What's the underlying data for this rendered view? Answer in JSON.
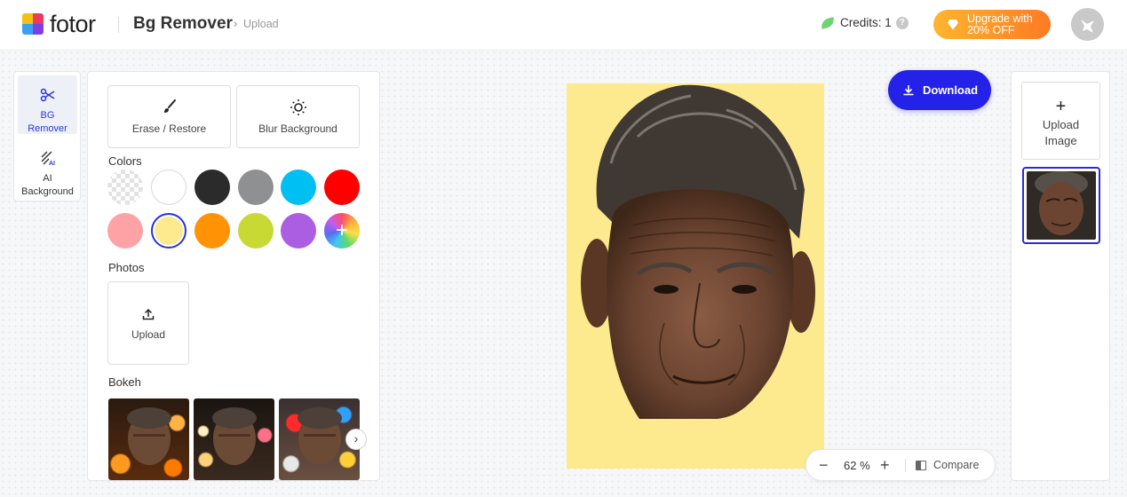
{
  "header": {
    "logo_text": "fotor",
    "product": "Bg Remover",
    "breadcrumb": "Upload",
    "credits": "Credits: 1",
    "upgrade_line1": "Upgrade with",
    "upgrade_line2": "20% OFF"
  },
  "rail": {
    "items": [
      {
        "line1": "BG",
        "line2": "Remover",
        "icon": "scissors-icon",
        "active": true
      },
      {
        "line1": "AI",
        "line2": "Background",
        "icon": "ai-background-icon",
        "active": false
      }
    ]
  },
  "panel": {
    "tools": [
      {
        "label": "Erase / Restore",
        "icon": "brush-icon"
      },
      {
        "label": "Blur Background",
        "icon": "blur-icon"
      }
    ],
    "colors_title": "Colors",
    "colors": [
      "transparent",
      "#ffffff",
      "#2b2b2b",
      "#8e9091",
      "#00bff3",
      "#ff0000",
      "#ffa2a6",
      "#fdea8f",
      "#ff9205",
      "#c9d934",
      "#ac5ee3",
      "custom"
    ],
    "selected_color": "#fdea8f",
    "photos_title": "Photos",
    "upload_label": "Upload",
    "bokeh_title": "Bokeh"
  },
  "editor": {
    "download_label": "Download",
    "zoom": "62 %",
    "compare_label": "Compare",
    "background_color": "#fdea8f"
  },
  "strip": {
    "upload_line1": "Upload",
    "upload_line2": "Image"
  }
}
